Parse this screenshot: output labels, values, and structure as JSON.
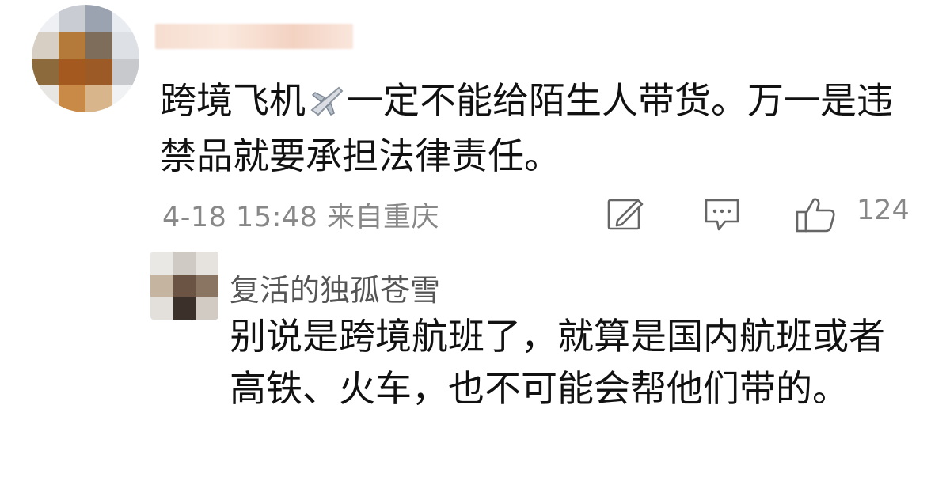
{
  "comment": {
    "text_part1": "跨境飞机",
    "text_part2": "一定不能给陌生人带货。万一是违禁品就要承担法律责任。",
    "emoji_icon": "airplane-icon",
    "meta": "4-18 15:48 来自重庆",
    "actions": {
      "repost_icon": "repost-edit-icon",
      "comment_icon": "comment-bubble-icon",
      "like_icon": "thumbs-up-icon",
      "like_count": "124"
    }
  },
  "reply": {
    "username": "复活的独孤苍雪",
    "text": "别说是跨境航班了，就算是国内航班或者高铁、火车，也不可能会帮他们带的。"
  }
}
